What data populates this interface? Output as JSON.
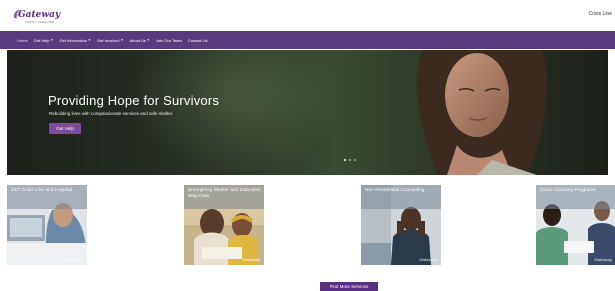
{
  "header": {
    "logo_text": "Gateway",
    "logo_subtext": "FAMILY SERVICES",
    "crisis_link": "Crisis Line"
  },
  "nav": {
    "items": [
      {
        "label": "Home",
        "has_caret": false
      },
      {
        "label": "Get Help",
        "has_caret": true
      },
      {
        "label": "Get Information",
        "has_caret": true
      },
      {
        "label": "Get Involved",
        "has_caret": true
      },
      {
        "label": "About Us",
        "has_caret": true
      },
      {
        "label": "Join Our Team",
        "has_caret": false
      },
      {
        "label": "Contact Us",
        "has_caret": false
      }
    ]
  },
  "hero": {
    "title": "Providing Hope for Survivors",
    "subtitle": "Rebuilding lives with compassionate services and safe shelter.",
    "button_label": "Get Help",
    "slides_count": 3,
    "active_slide": 1
  },
  "services": [
    {
      "label": "24/7 Crisis Line and Hospital",
      "logo": "Gateway"
    },
    {
      "label": "Emergency Shelter and Extended Stay Care",
      "logo": "Gateway"
    },
    {
      "label": "Non-Residential Counseling",
      "logo": "Gateway"
    },
    {
      "label": "Court Advocacy Programs",
      "logo": "Gateway"
    }
  ],
  "find_more_label": "Find More Services",
  "colors": {
    "brand_purple": "#5d3a7e",
    "button_purple": "#7a4c9a",
    "card_label_overlay": "#788796"
  }
}
